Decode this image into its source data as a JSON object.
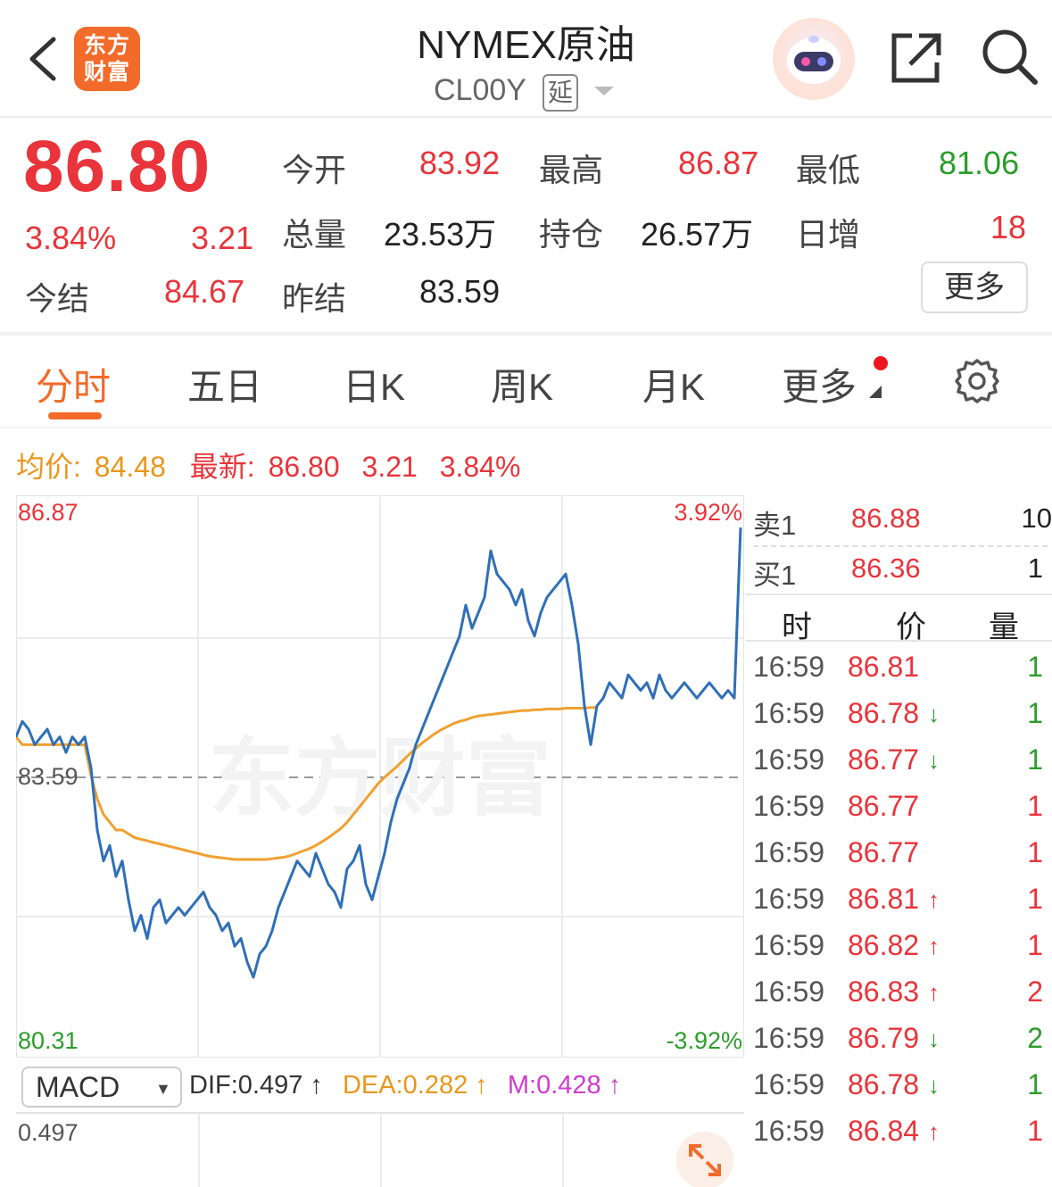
{
  "header": {
    "title": "NYMEX原油",
    "symbol": "CL00Y",
    "delay_badge": "延",
    "logo_line1": "东方",
    "logo_line2": "财富"
  },
  "quote": {
    "last": "86.80",
    "change_pct": "3.84%",
    "change": "3.21",
    "settle_label": "今结",
    "settle": "84.67",
    "open_label": "今开",
    "open": "83.92",
    "volume_label": "总量",
    "volume": "23.53万",
    "prev_settle_label": "昨结",
    "prev_settle": "83.59",
    "high_label": "最高",
    "high": "86.87",
    "oi_label": "持仓",
    "oi": "26.57万",
    "low_label": "最低",
    "low": "81.06",
    "daily_inc_label": "日增",
    "daily_inc": "18",
    "more_label": "更多"
  },
  "tabs": [
    "分时",
    "五日",
    "日K",
    "周K",
    "月K",
    "更多"
  ],
  "avg_line": {
    "avg_label": "均价:",
    "avg_value": "84.48",
    "latest_label": "最新:",
    "latest_value": "86.80",
    "latest_change": "3.21",
    "latest_pct": "3.84%"
  },
  "chart_data": {
    "type": "line",
    "y_top": "86.87",
    "y_mid": "83.59",
    "y_bottom": "80.31",
    "pct_top": "3.92%",
    "pct_bottom": "-3.92%",
    "ylim": [
      80.31,
      86.87
    ],
    "reference": 83.59,
    "watermark": "东方财富",
    "series": [
      {
        "name": "price",
        "color": "#2f6fb8",
        "values": [
          84.1,
          84.3,
          84.2,
          84.0,
          84.1,
          84.2,
          84.0,
          84.1,
          83.9,
          84.1,
          84.0,
          84.1,
          83.7,
          82.9,
          82.5,
          82.7,
          82.3,
          82.5,
          82.0,
          81.6,
          81.8,
          81.5,
          81.9,
          82.0,
          81.7,
          81.8,
          81.9,
          81.8,
          81.9,
          82.0,
          82.1,
          81.9,
          81.8,
          81.6,
          81.7,
          81.4,
          81.5,
          81.2,
          81.0,
          81.3,
          81.4,
          81.6,
          81.9,
          82.1,
          82.3,
          82.5,
          82.4,
          82.3,
          82.6,
          82.4,
          82.2,
          82.1,
          81.9,
          82.4,
          82.5,
          82.7,
          82.2,
          82.0,
          82.3,
          82.6,
          83.0,
          83.3,
          83.5,
          83.7,
          84.0,
          84.2,
          84.4,
          84.6,
          84.8,
          85.0,
          85.2,
          85.4,
          85.8,
          85.5,
          85.7,
          85.9,
          86.5,
          86.2,
          86.1,
          86.0,
          85.8,
          86.0,
          85.6,
          85.4,
          85.7,
          85.9,
          86.0,
          86.1,
          86.2,
          85.8,
          85.3,
          84.5,
          84.0,
          84.5,
          84.6,
          84.8,
          84.7,
          84.6,
          84.9,
          84.8,
          84.7,
          84.8,
          84.6,
          84.9,
          84.7,
          84.6,
          84.7,
          84.8,
          84.7,
          84.6,
          84.7,
          84.8,
          84.7,
          84.6,
          84.7,
          84.6,
          86.8
        ]
      },
      {
        "name": "avg",
        "color": "#f0a030",
        "values": [
          84.1,
          84.0,
          84.0,
          84.0,
          84.0,
          84.0,
          84.0,
          84.0,
          84.0,
          84.0,
          84.0,
          84.0,
          83.6,
          83.3,
          83.1,
          83.0,
          82.9,
          82.9,
          82.85,
          82.8,
          82.78,
          82.76,
          82.74,
          82.72,
          82.7,
          82.68,
          82.66,
          82.64,
          82.62,
          82.6,
          82.58,
          82.56,
          82.55,
          82.54,
          82.53,
          82.52,
          82.52,
          82.52,
          82.52,
          82.52,
          82.52,
          82.53,
          82.54,
          82.55,
          82.57,
          82.6,
          82.63,
          82.66,
          82.7,
          82.75,
          82.8,
          82.86,
          82.92,
          83.0,
          83.1,
          83.2,
          83.3,
          83.4,
          83.5,
          83.58,
          83.65,
          83.72,
          83.8,
          83.88,
          83.95,
          84.02,
          84.08,
          84.14,
          84.19,
          84.23,
          84.27,
          84.3,
          84.32,
          84.35,
          84.37,
          84.38,
          84.39,
          84.4,
          84.41,
          84.42,
          84.43,
          84.44,
          84.44,
          84.45,
          84.45,
          84.46,
          84.46,
          84.46,
          84.47,
          84.47,
          84.47,
          84.47,
          84.48,
          84.48
        ]
      }
    ]
  },
  "order_book": {
    "sell_label": "卖1",
    "sell_price": "86.88",
    "sell_vol": "10",
    "buy_label": "买1",
    "buy_price": "86.36",
    "buy_vol": "1"
  },
  "ticks_header": {
    "time": "时",
    "price": "价",
    "vol": "量"
  },
  "ticks": [
    {
      "time": "16:59",
      "price": "86.81",
      "arrow": "",
      "vol": "1",
      "vc": "green"
    },
    {
      "time": "16:59",
      "price": "86.78",
      "arrow": "↓",
      "vol": "1",
      "vc": "green"
    },
    {
      "time": "16:59",
      "price": "86.77",
      "arrow": "↓",
      "vol": "1",
      "vc": "green"
    },
    {
      "time": "16:59",
      "price": "86.77",
      "arrow": "",
      "vol": "1",
      "vc": "red"
    },
    {
      "time": "16:59",
      "price": "86.77",
      "arrow": "",
      "vol": "1",
      "vc": "red"
    },
    {
      "time": "16:59",
      "price": "86.81",
      "arrow": "↑",
      "vol": "1",
      "vc": "red"
    },
    {
      "time": "16:59",
      "price": "86.82",
      "arrow": "↑",
      "vol": "1",
      "vc": "red"
    },
    {
      "time": "16:59",
      "price": "86.83",
      "arrow": "↑",
      "vol": "2",
      "vc": "red"
    },
    {
      "time": "16:59",
      "price": "86.79",
      "arrow": "↓",
      "vol": "2",
      "vc": "green"
    },
    {
      "time": "16:59",
      "price": "86.78",
      "arrow": "↓",
      "vol": "1",
      "vc": "green"
    },
    {
      "time": "16:59",
      "price": "86.84",
      "arrow": "↑",
      "vol": "1",
      "vc": "red"
    }
  ],
  "macd": {
    "indicator": "MACD",
    "dif": "DIF:0.497 ↑",
    "dea": "DEA:0.282 ↑",
    "m": "M:0.428 ↑",
    "top_value": "0.497"
  },
  "colors": {
    "up": "#e8343a",
    "down": "#2a9d2a",
    "accent": "#f26b2a",
    "price_line": "#2f6fb8",
    "avg_line": "#f0a030"
  }
}
